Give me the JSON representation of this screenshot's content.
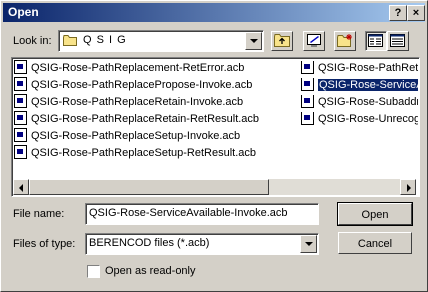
{
  "window": {
    "title": "Open",
    "help_label": "?",
    "close_label": "×"
  },
  "toolbar": {
    "lookin_label": "Look in:",
    "lookin_value": "Q S I G",
    "buttons": [
      "up-one-level",
      "desktop",
      "create-new-folder",
      "list-view",
      "details-view"
    ]
  },
  "files": {
    "column1": [
      "QSIG-Rose-PathReplacement-RetError.acb",
      "QSIG-Rose-PathReplacePropose-Invoke.acb",
      "QSIG-Rose-PathReplaceRetain-Invoke.acb",
      "QSIG-Rose-PathReplaceRetain-RetResult.acb",
      "QSIG-Rose-PathReplaceSetup-Invoke.acb",
      "QSIG-Rose-PathReplaceSetup-RetResult.acb"
    ],
    "column2": [
      "QSIG-Rose-PathReta",
      "QSIG-Rose-ServiceA",
      "QSIG-Rose-Subaddre",
      "QSIG-Rose-Unrecogr"
    ],
    "selected_index_column2": 1
  },
  "form": {
    "filename_label": "File name:",
    "filename_value": "QSIG-Rose-ServiceAvailable-Invoke.acb",
    "filetype_label": "Files of type:",
    "filetype_value": "BERENCOD files (*.acb)",
    "readonly_label": "Open as read-only",
    "readonly_checked": false
  },
  "actions": {
    "open_label": "Open",
    "cancel_label": "Cancel"
  },
  "colors": {
    "titlebar_start": "#0a246a",
    "titlebar_end": "#a6caf0",
    "selection": "#0a246a",
    "face": "#d4d0c8"
  }
}
